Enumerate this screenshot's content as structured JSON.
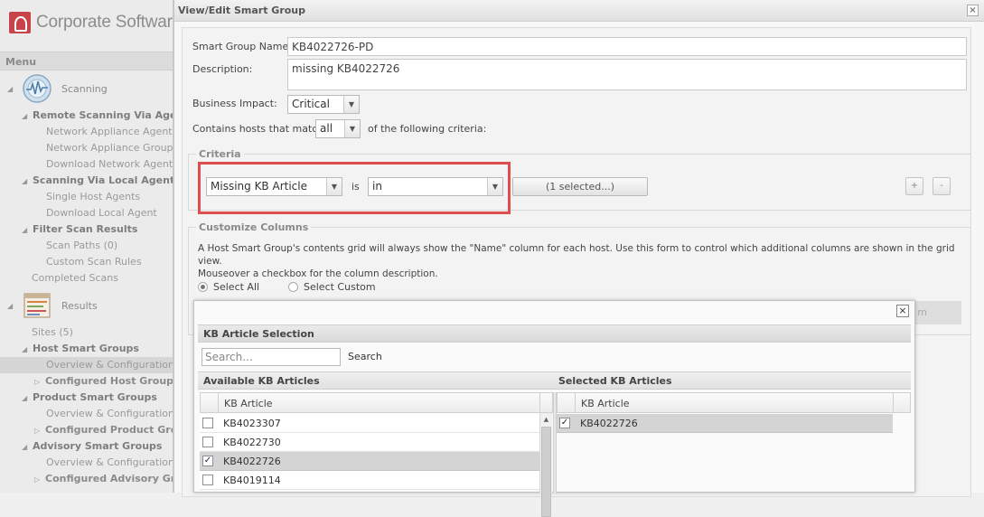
{
  "app": {
    "logo_text": "Corporate Software",
    "menu_label": "Menu"
  },
  "sidebar": {
    "scanning_label": "Scanning",
    "results_label": "Results",
    "items": [
      {
        "label": "Remote Scanning Via Agents",
        "level": "l1"
      },
      {
        "label": "Network Appliance Agents",
        "level": "l2"
      },
      {
        "label": "Network Appliance Groups",
        "level": "l2"
      },
      {
        "label": "Download Network Agent",
        "level": "l2"
      },
      {
        "label": "Scanning Via Local Agents",
        "level": "l1"
      },
      {
        "label": "Single Host Agents",
        "level": "l2"
      },
      {
        "label": "Download Local Agent",
        "level": "l2"
      },
      {
        "label": "Filter Scan Results",
        "level": "l1"
      },
      {
        "label": "Scan Paths (0)",
        "level": "l2"
      },
      {
        "label": "Custom Scan Rules",
        "level": "l2"
      },
      {
        "label": "Completed Scans",
        "level": "l1s"
      }
    ],
    "results_items": [
      {
        "label": "Sites (5)",
        "level": "l1s"
      },
      {
        "label": "Host Smart Groups",
        "level": "l1"
      },
      {
        "label": "Overview & Configuration",
        "level": "l2",
        "active": true
      },
      {
        "label": "Configured Host Groups (",
        "level": "bold2"
      },
      {
        "label": "Product Smart Groups",
        "level": "l1"
      },
      {
        "label": "Overview & Configuration",
        "level": "l2"
      },
      {
        "label": "Configured Product Grou",
        "level": "bold2"
      },
      {
        "label": "Advisory Smart Groups",
        "level": "l1"
      },
      {
        "label": "Overview & Configuration",
        "level": "l2"
      },
      {
        "label": "Configured Advisory Grou",
        "level": "bold2"
      }
    ]
  },
  "dialog": {
    "title": "View/Edit Smart Group",
    "close_glyph": "×",
    "name_label": "Smart Group Name:",
    "name_value": "KB4022726-PD",
    "desc_label": "Description:",
    "desc_value": "missing KB4022726",
    "impact_label": "Business Impact:",
    "impact_value": "Critical",
    "match_label_pre": "Contains hosts that match",
    "match_value": "all",
    "match_label_post": "of the following criteria:",
    "criteria_legend": "Criteria",
    "criteria_field": "Missing KB Article",
    "criteria_is": "is",
    "criteria_op": "in",
    "criteria_selected": "(1 selected...)",
    "add_glyph": "+",
    "remove_glyph": "-",
    "columns_legend": "Customize Columns",
    "columns_text_1": "A Host Smart Group's contents grid will always show the \"Name\" column for each host. Use this form to control which additional columns are shown in the grid view.",
    "columns_text_2": "Mouseover a checkbox for the column description.",
    "select_all": "Select All",
    "select_custom": "Select Custom",
    "hidden_tail": "m"
  },
  "kb_popup": {
    "title": "KB Article Selection",
    "close_glyph": "×",
    "search_placeholder": "Search...",
    "search_button": "Search",
    "available_title": "Available KB Articles",
    "selected_title": "Selected KB Articles",
    "col_header": "KB Article",
    "available": [
      {
        "id": "KB4023307",
        "checked": false
      },
      {
        "id": "KB4022730",
        "checked": false
      },
      {
        "id": "KB4022726",
        "checked": true
      },
      {
        "id": "KB4019114",
        "checked": false
      }
    ],
    "selected": [
      {
        "id": "KB4022726",
        "checked": true
      }
    ]
  },
  "colors": {
    "highlight": "#e04d4f",
    "brand": "#c9434a"
  }
}
